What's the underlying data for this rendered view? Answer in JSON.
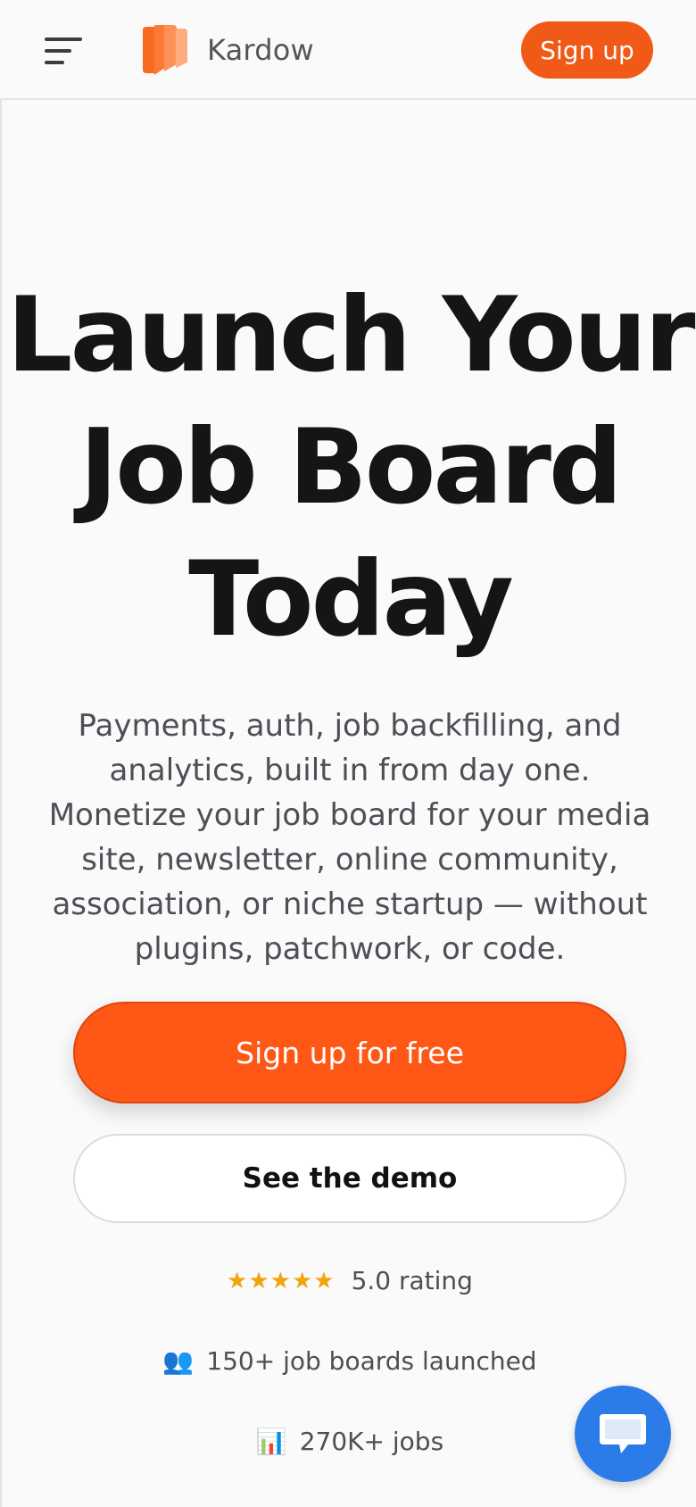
{
  "brand": {
    "name": "Kardow",
    "accent": "#f05a16",
    "cta_color": "#ff5715",
    "chat_color": "#2b7be9"
  },
  "header": {
    "menu_icon": "hamburger-menu-icon",
    "logo_icon": "kardow-logo-icon",
    "signup_label": "Sign up"
  },
  "hero": {
    "title_lines": [
      "Launch Your",
      "Job Board",
      "Today"
    ],
    "description_lines": [
      "Payments, auth, job backfilling, and",
      "analytics, built in from day one.",
      "Monetize your job board for your media",
      "site, newsletter, online community,",
      "association, or niche startup — without",
      "plugins, patchwork, or code."
    ],
    "primary_cta": "Sign up for free",
    "secondary_cta": "See the demo"
  },
  "stats": {
    "rating": {
      "stars": "★★★★★",
      "star_count": 5,
      "label": "5.0 rating"
    },
    "boards": {
      "icon": "👥",
      "label": "150+ job boards launched"
    },
    "jobs": {
      "icon": "📊",
      "label": "270K+ jobs"
    }
  },
  "chat": {
    "icon": "chat-bubble-icon"
  }
}
